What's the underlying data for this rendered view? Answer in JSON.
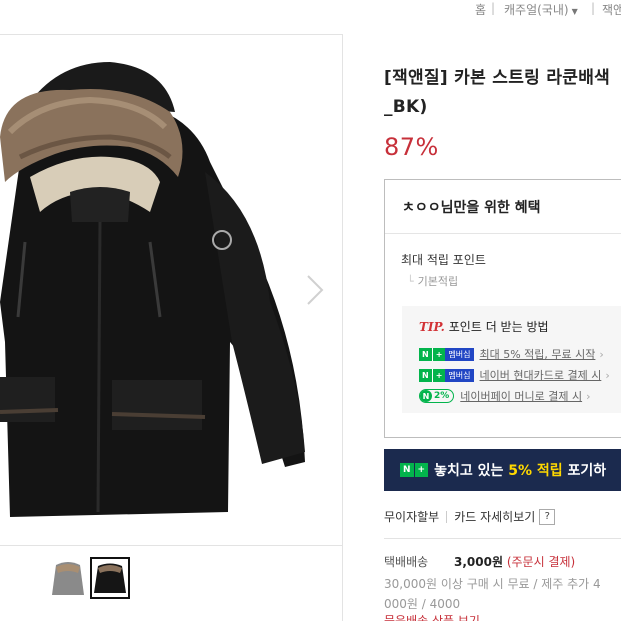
{
  "breadcrumb": {
    "home": "홈",
    "category": "캐주얼(국내)",
    "brand": "잭앤"
  },
  "product": {
    "title_line1": "[잭앤질] 카본 스트링 라쿤배색",
    "title_line2": "_BK)",
    "discount": "87%"
  },
  "benefit": {
    "title": "ㅊㅇㅇ님만을 위한 혜택",
    "points_label": "최대 적립 포인트",
    "points_sub": "기본적립",
    "tip_label": "TIP.",
    "tip_text": "포인트 더 받는 방법",
    "rows": [
      {
        "badge": "멤버십",
        "text": "최대 5% 적립, 무료 시작"
      },
      {
        "badge": "멤버십",
        "text": "네이버 현대카드로 결제 시"
      },
      {
        "badge": "2%",
        "text": "네이버페이 머니로 결제 시"
      }
    ]
  },
  "banner": {
    "prefix": "놓치고 있는",
    "highlight": "5% 적립",
    "suffix": "포기하"
  },
  "payment": {
    "installment": "무이자할부",
    "card_detail": "카드 자세히보기",
    "help": "?"
  },
  "shipping": {
    "label": "택배배송",
    "fee": "3,000원",
    "fee_note": "(주문시 결제)",
    "detail_line1": "30,000원 이상 구매 시 무료 / 제주 추가 4",
    "detail_line2": "000원 / 4000",
    "more": "묶음배송 상품 보기"
  },
  "icons": {
    "next": "chevron-right-icon",
    "dropdown": "triangle-down-icon"
  },
  "colors": {
    "accent_red": "#c7303a",
    "naver_green": "#03b44c",
    "banner_navy": "#1b2a4e",
    "banner_highlight": "#ffd800"
  }
}
